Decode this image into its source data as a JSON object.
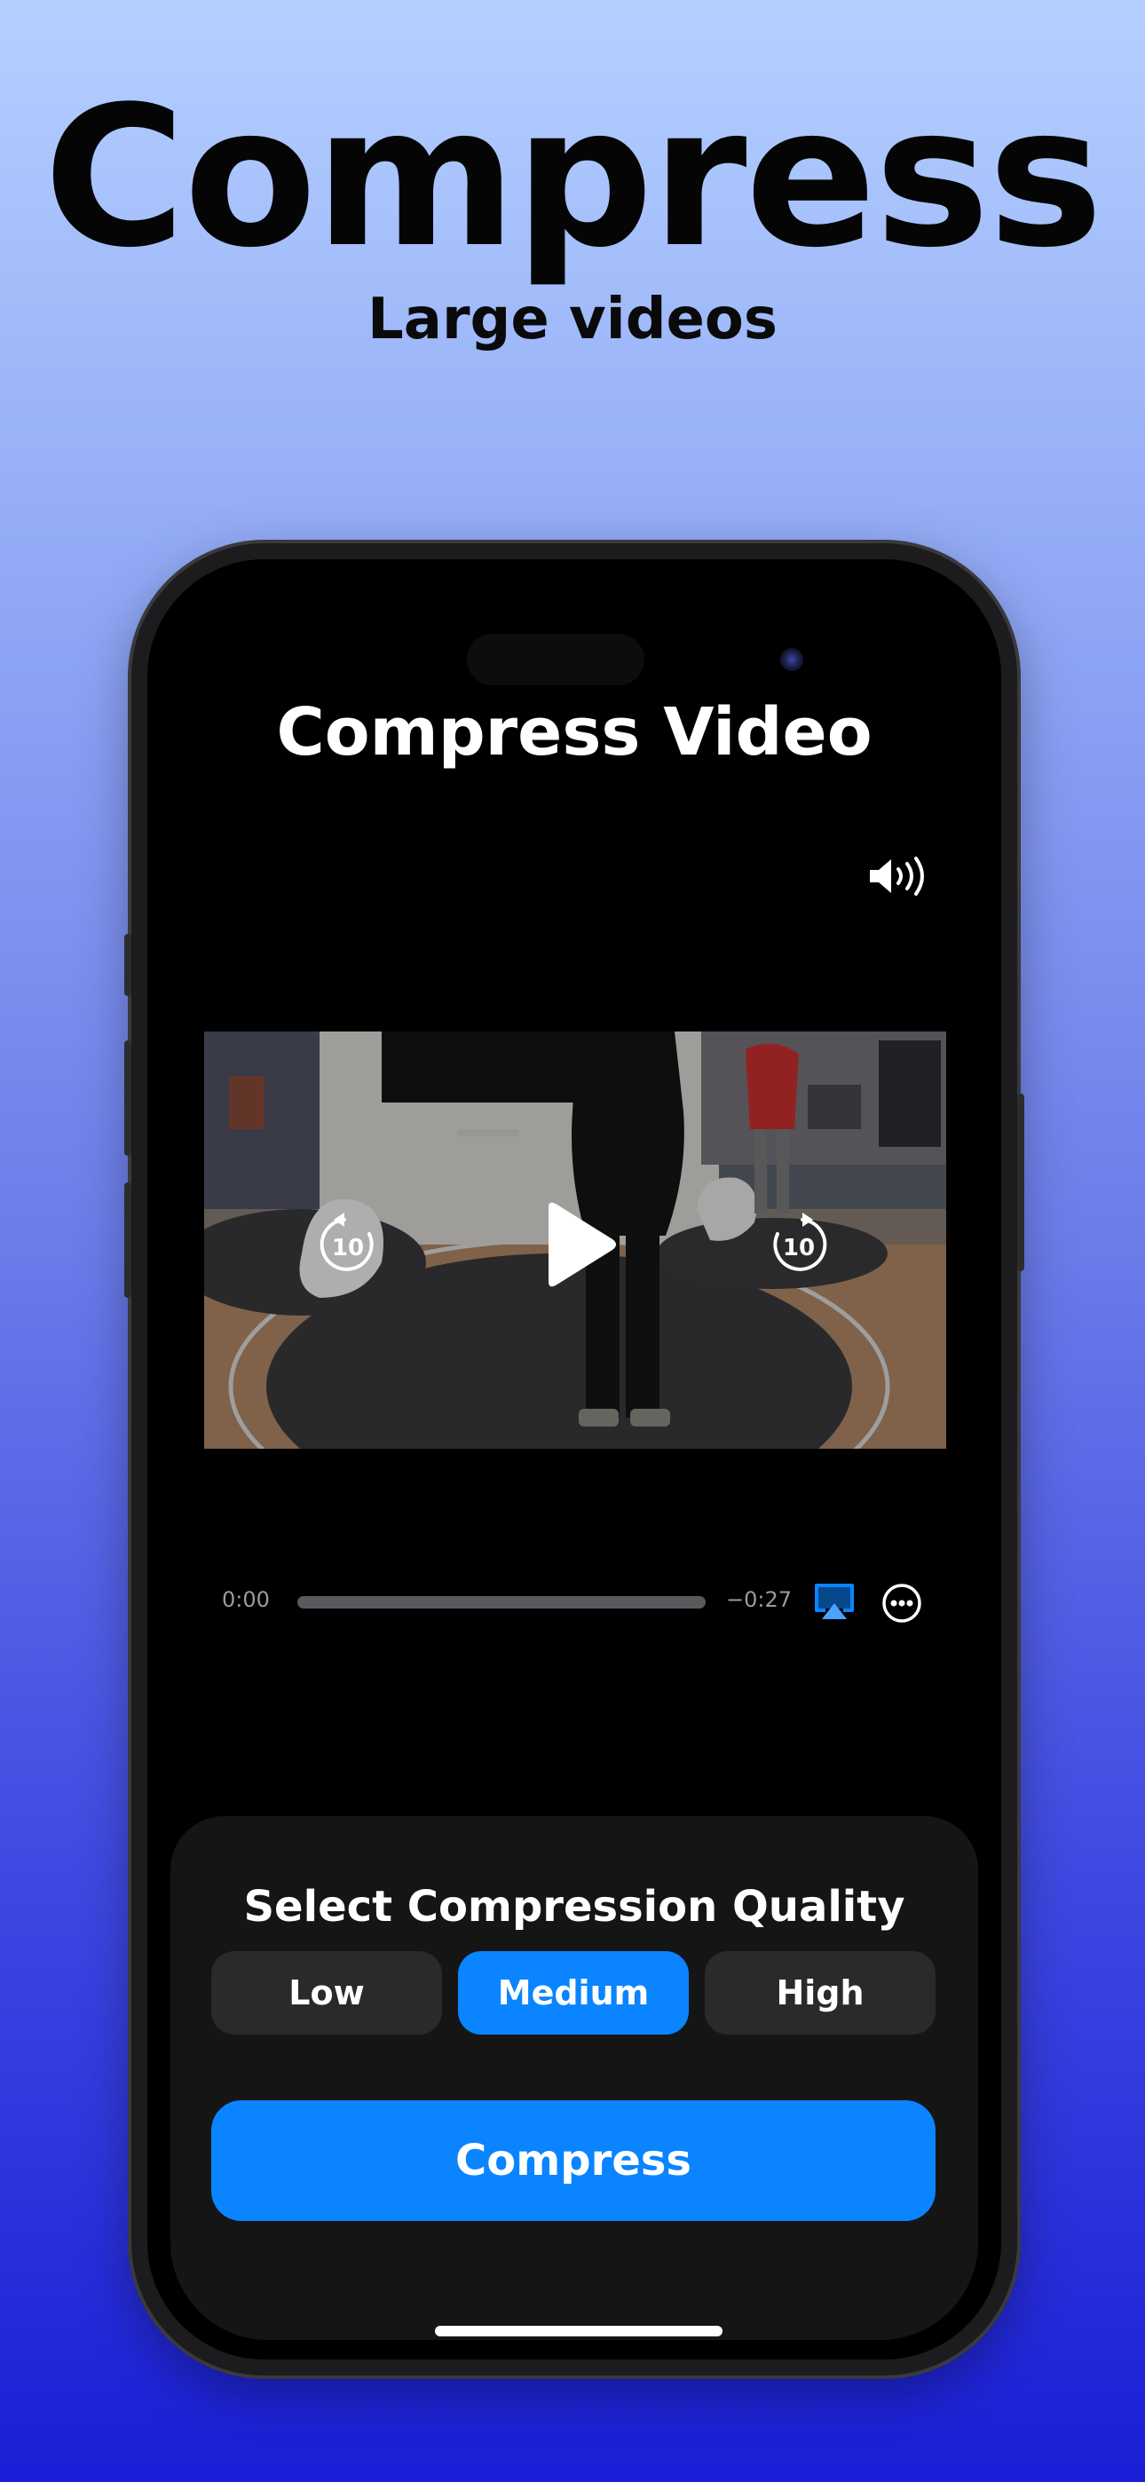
{
  "hero": {
    "title": "Compress",
    "subtitle": "Large videos"
  },
  "screen": {
    "title": "Compress Video",
    "player": {
      "skip_back_label": "10",
      "skip_forward_label": "10",
      "time_elapsed": "0:00",
      "time_remaining": "−0:27",
      "progress": 0
    },
    "quality_panel": {
      "title": "Select Compression Quality",
      "options": [
        "Low",
        "Medium",
        "High"
      ],
      "selected": "Medium"
    },
    "compress_button": "Compress"
  },
  "colors": {
    "accent": "#0a84ff",
    "panel": "#151515",
    "segment": "#2a2a2c"
  },
  "icons": [
    "volume-icon",
    "play-icon",
    "skip-back-10-icon",
    "skip-forward-10-icon",
    "airplay-icon",
    "more-icon"
  ]
}
